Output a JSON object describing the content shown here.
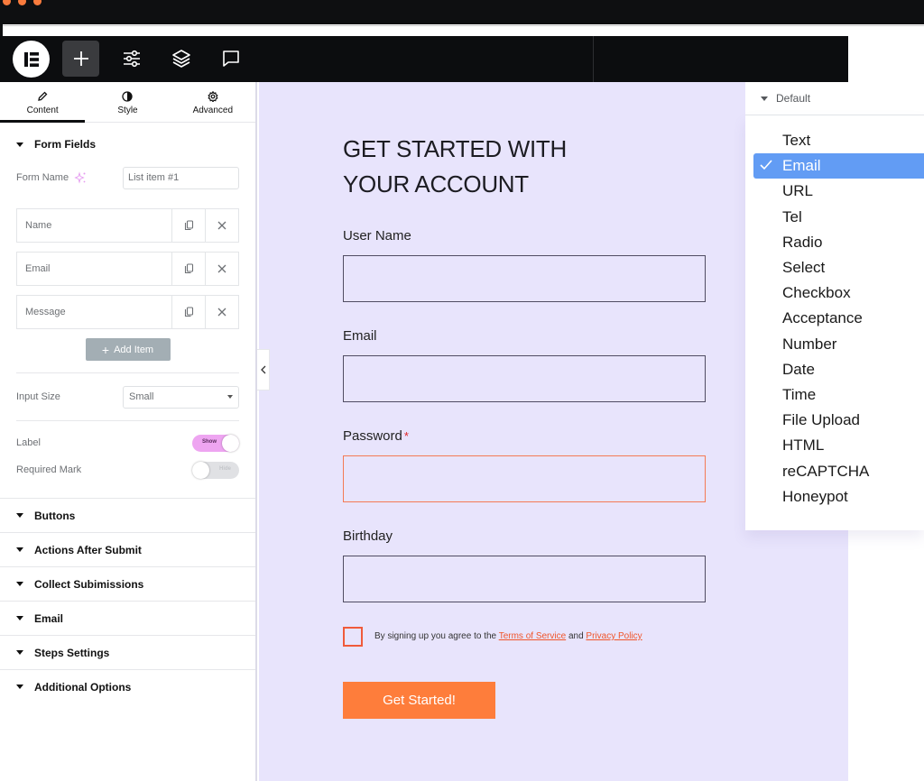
{
  "window": {
    "traffic_dots": [
      "orange",
      "orange",
      "orange"
    ],
    "accent_color": "#f97b3d"
  },
  "toolbar": {
    "logo_icon": "elementor-logo",
    "buttons": [
      {
        "icon": "plus-icon",
        "active": true
      },
      {
        "icon": "sliders-icon",
        "active": false
      },
      {
        "icon": "layers-icon",
        "active": false
      },
      {
        "icon": "comment-icon",
        "active": false
      }
    ]
  },
  "panel": {
    "tabs": [
      {
        "label": "Content",
        "icon": "pencil-icon",
        "active": true
      },
      {
        "label": "Style",
        "icon": "contrast-icon",
        "active": false
      },
      {
        "label": "Advanced",
        "icon": "gear-icon",
        "active": false
      }
    ],
    "form_fields": {
      "title": "Form Fields",
      "form_name_label": "Form Name",
      "form_name_value": "List item #1",
      "items": [
        {
          "name": "Name"
        },
        {
          "name": "Email"
        },
        {
          "name": "Message"
        }
      ],
      "add_item_label": "Add Item",
      "input_size_label": "Input Size",
      "input_size_value": "Small",
      "label_toggle": {
        "label": "Label",
        "state_text": "Show",
        "on": true
      },
      "required_mark_toggle": {
        "label": "Required Mark",
        "state_text": "Hide",
        "on": false
      }
    },
    "sections": [
      "Buttons",
      "Actions After Submit",
      "Collect Subimissions",
      "Email",
      "Steps Settings",
      "Additional Options"
    ]
  },
  "canvas": {
    "background": "#e8e4fc",
    "title": "GET STARTED WITH YOUR ACCOUNT",
    "fields": [
      {
        "label": "User Name",
        "required": false,
        "value": ""
      },
      {
        "label": "Email",
        "required": false,
        "value": ""
      },
      {
        "label": "Password",
        "required": true,
        "value": ""
      },
      {
        "label": "Birthday",
        "required": false,
        "value": ""
      }
    ],
    "required_mark": "*",
    "agreement": {
      "checked": false,
      "prefix": "By signing up you agree to the",
      "terms_link": "Terms of Service",
      "conjunction": "and",
      "privacy_link": "Privacy Policy"
    },
    "submit_label": "Get Started!",
    "submit_color": "#fe7d3b"
  },
  "dropdown": {
    "header": "Default",
    "selected": "Email",
    "selected_color": "#629cf4",
    "options": [
      "Text",
      "Email",
      "URL",
      "Tel",
      "Radio",
      "Select",
      "Checkbox",
      "Acceptance",
      "Number",
      "Date",
      "Time",
      "File Upload",
      "HTML",
      "reCAPTCHA",
      "Honeypot"
    ]
  }
}
